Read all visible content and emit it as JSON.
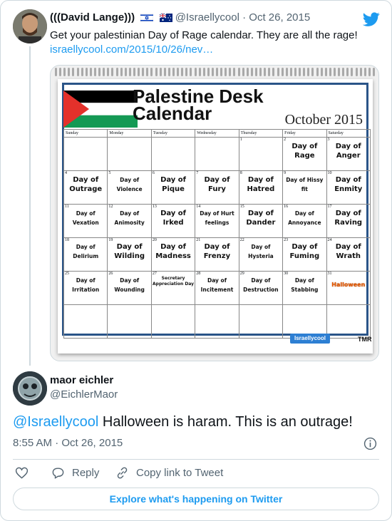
{
  "parent": {
    "name": "(((David Lange)))",
    "flags": "🇮🇱 🇦🇺",
    "handle": "@Israellycool",
    "date": "Oct 26, 2015",
    "text": "Get your palestinian Day of Rage calendar. They are all the rage!",
    "link": "israellycool.com/2015/10/26/nev…"
  },
  "calendar": {
    "title_line1": "Palestine Desk",
    "title_line2": "Calendar",
    "month": "October 2015",
    "weekdays": [
      "Sunday",
      "Monday",
      "Tuesday",
      "Wednesday",
      "Thursday",
      "Friday",
      "Saturday"
    ],
    "weeks": [
      [
        {
          "n": "",
          "e": ""
        },
        {
          "n": "",
          "e": ""
        },
        {
          "n": "",
          "e": ""
        },
        {
          "n": "",
          "e": ""
        },
        {
          "n": "1",
          "e": ""
        },
        {
          "n": "2",
          "e": "Day of Rage"
        },
        {
          "n": "3",
          "e": "Day of Anger"
        }
      ],
      [
        {
          "n": "4",
          "e": "Day of Outrage"
        },
        {
          "n": "5",
          "e": "Day of Violence"
        },
        {
          "n": "6",
          "e": "Day of Pique"
        },
        {
          "n": "7",
          "e": "Day of Fury"
        },
        {
          "n": "8",
          "e": "Day of Hatred"
        },
        {
          "n": "9",
          "e": "Day of Hissy fit"
        },
        {
          "n": "10",
          "e": "Day of Enmity"
        }
      ],
      [
        {
          "n": "11",
          "e": "Day of Vexation"
        },
        {
          "n": "12",
          "e": "Day of Animosity"
        },
        {
          "n": "13",
          "e": "Day of Irked"
        },
        {
          "n": "14",
          "e": "Day of Hurt feelings"
        },
        {
          "n": "15",
          "e": "Day of Dander"
        },
        {
          "n": "16",
          "e": "Day of Annoyance"
        },
        {
          "n": "17",
          "e": "Day of Raving"
        }
      ],
      [
        {
          "n": "18",
          "e": "Day of Delirium"
        },
        {
          "n": "19",
          "e": "Day of Wilding"
        },
        {
          "n": "20",
          "e": "Day of Madness"
        },
        {
          "n": "21",
          "e": "Day of Frenzy"
        },
        {
          "n": "22",
          "e": "Day of Hysteria"
        },
        {
          "n": "23",
          "e": "Day of Fuming"
        },
        {
          "n": "24",
          "e": "Day of Wrath"
        }
      ],
      [
        {
          "n": "25",
          "e": "Day of Irritation"
        },
        {
          "n": "26",
          "e": "Day of Wounding"
        },
        {
          "n": "27",
          "e": "Secretary Appreciation Day"
        },
        {
          "n": "28",
          "e": "Day of Incitement"
        },
        {
          "n": "29",
          "e": "Day of Destruction"
        },
        {
          "n": "30",
          "e": "Day of Stabbing"
        },
        {
          "n": "31",
          "e": "Halloween"
        }
      ],
      [
        {
          "n": "",
          "e": ""
        },
        {
          "n": "",
          "e": ""
        },
        {
          "n": "",
          "e": ""
        },
        {
          "n": "",
          "e": ""
        },
        {
          "n": "",
          "e": ""
        },
        {
          "n": "",
          "e": ""
        },
        {
          "n": "",
          "e": ""
        }
      ]
    ],
    "logo_text": "Israellycool",
    "credit": "TMR",
    "flag_colors": {
      "black": "#000000",
      "white": "#ffffff",
      "green": "#149954",
      "red": "#e4312b"
    }
  },
  "reply": {
    "name": "maor eichler",
    "handle": "@EichlerMaor",
    "mention": "@Israellycool",
    "text": " Halloween is haram. This is an outrage!",
    "timestamp": "8:55 AM · Oct 26, 2015"
  },
  "actions": {
    "reply_label": "Reply",
    "copy_label": "Copy link to Tweet"
  },
  "explore_label": "Explore what's happening on Twitter",
  "icons": [
    "twitter-bird-icon",
    "info-icon",
    "heart-icon",
    "reply-icon",
    "link-icon"
  ],
  "colors": {
    "accent": "#1d9bf0",
    "text": "#0f1419",
    "muted": "#536471",
    "border": "#cfd9de",
    "calendar_border": "#2a5488"
  }
}
